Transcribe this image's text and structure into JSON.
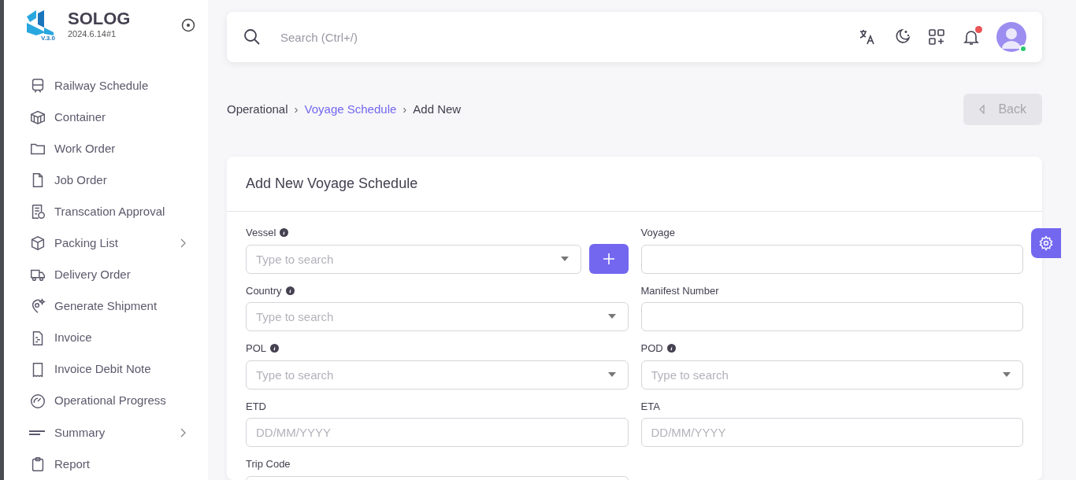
{
  "brand": {
    "name": "SOLOG",
    "version": "2024.6.14#1",
    "logo_caption": "V.3.0"
  },
  "breadcrumb_separator": "›",
  "sidebar": {
    "items": [
      {
        "label": "Railway Schedule",
        "has_children": false
      },
      {
        "label": "Container",
        "has_children": false
      },
      {
        "label": "Work Order",
        "has_children": false
      },
      {
        "label": "Job Order",
        "has_children": false
      },
      {
        "label": "Transcation Approval",
        "has_children": false
      },
      {
        "label": "Packing List",
        "has_children": true
      },
      {
        "label": "Delivery Order",
        "has_children": false
      },
      {
        "label": "Generate Shipment",
        "has_children": false
      },
      {
        "label": "Invoice",
        "has_children": false
      },
      {
        "label": "Invoice Debit Note",
        "has_children": false
      },
      {
        "label": "Operational Progress",
        "has_children": false
      },
      {
        "label": "Summary",
        "has_children": true
      },
      {
        "label": "Report",
        "has_children": false
      }
    ]
  },
  "topbar": {
    "search": {
      "placeholder": "Search (Ctrl+/)"
    },
    "notification_dot": true,
    "online": true
  },
  "breadcrumb": [
    {
      "label": "Operational",
      "link": false
    },
    {
      "label": "Voyage Schedule",
      "link": true
    },
    {
      "label": "Add New",
      "link": false
    }
  ],
  "back_button": {
    "label": "Back",
    "disabled": true
  },
  "form": {
    "title": "Add New Voyage Schedule",
    "fields": [
      {
        "label": "Vessel",
        "kind": "select",
        "info": true,
        "placeholder": "Type to search",
        "add_button": true
      },
      {
        "label": "Voyage",
        "kind": "text",
        "info": false
      },
      {
        "label": "Country",
        "kind": "select",
        "info": true,
        "placeholder": "Type to search",
        "add_button": false
      },
      {
        "label": "Manifest Number",
        "kind": "text",
        "info": false
      },
      {
        "label": "POL",
        "kind": "select",
        "info": true,
        "placeholder": "Type to search",
        "add_button": false
      },
      {
        "label": "POD",
        "kind": "select",
        "info": true,
        "placeholder": "Type to search",
        "add_button": false
      },
      {
        "label": "ETD",
        "kind": "date",
        "info": false,
        "placeholder": "DD/MM/YYYY"
      },
      {
        "label": "ETA",
        "kind": "date",
        "info": false,
        "placeholder": "DD/MM/YYYY"
      },
      {
        "label": "Trip Code",
        "kind": "text",
        "info": false
      }
    ]
  }
}
